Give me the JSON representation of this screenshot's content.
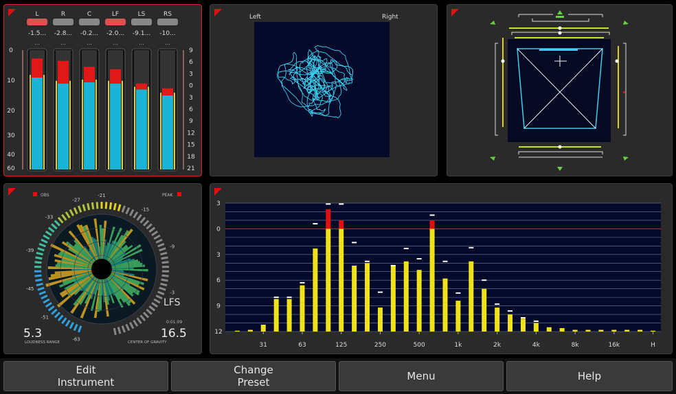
{
  "level_meter": {
    "channels": [
      {
        "label": "L",
        "value": "-1.5...",
        "peak": "...",
        "over": true,
        "level": 0.77,
        "peak_level": 0.93
      },
      {
        "label": "R",
        "value": "-2.8...",
        "peak": "...",
        "over": false,
        "level": 0.72,
        "peak_level": 0.91
      },
      {
        "label": "C",
        "value": "-0.2...",
        "peak": "...",
        "over": false,
        "level": 0.73,
        "peak_level": 0.86
      },
      {
        "label": "LF",
        "value": "-2.0...",
        "peak": "...",
        "over": true,
        "level": 0.72,
        "peak_level": 0.84
      },
      {
        "label": "LS",
        "value": "-9.1...",
        "peak": "...",
        "over": false,
        "level": 0.67,
        "peak_level": 0.72
      },
      {
        "label": "RS",
        "value": "-10...",
        "peak": "...",
        "over": false,
        "level": 0.62,
        "peak_level": 0.68
      }
    ],
    "left_scale": [
      "0",
      "10",
      "20",
      "30",
      "40",
      "60"
    ],
    "right_scale": [
      "9",
      "6",
      "3",
      "0",
      "3",
      "6",
      "9",
      "12",
      "15",
      "18",
      "21"
    ]
  },
  "vectorscope": {
    "left_label": "Left",
    "right_label": "Right"
  },
  "loudness": {
    "obs_label": "OBS",
    "peak_label": "PEAK",
    "scale": [
      "-21",
      "-15",
      "-9",
      "-3",
      "-63",
      "-51",
      "-45",
      "-39",
      "-33",
      "-27"
    ],
    "loudness_range_value": "5.3",
    "loudness_range_label": "LOUDNESS RANGE",
    "cog_value": "16.5",
    "cog_label": "CENTER OF GRAVITY",
    "mode": "LFS",
    "time": "0:01:09"
  },
  "spectrum": {
    "y_ticks": [
      "3",
      "0",
      "3",
      "6",
      "9",
      "12"
    ],
    "x_labels": [
      "31",
      "63",
      "125",
      "250",
      "500",
      "1k",
      "2k",
      "4k",
      "8k",
      "16k",
      "H"
    ],
    "chart_data": {
      "type": "bar",
      "ylabel": "",
      "xlabel": "",
      "ylim": [
        12,
        -3
      ],
      "values": [
        11.9,
        11.8,
        11.2,
        8.2,
        8.2,
        6.6,
        2.3,
        -2.3,
        -1.0,
        4.3,
        4.0,
        9.2,
        4.3,
        3.8,
        4.8,
        -1.0,
        5.8,
        8.4,
        3.8,
        7.0,
        9.2,
        10.0,
        10.5,
        11.0,
        11.5,
        11.6,
        11.8,
        11.8,
        11.8,
        11.8,
        11.8,
        11.8,
        11.9
      ],
      "peaks": [
        null,
        null,
        null,
        8.0,
        8.0,
        6.3,
        -0.6,
        -2.9,
        -2.9,
        1.6,
        3.8,
        7.4,
        4.3,
        2.3,
        3.5,
        -1.6,
        3.8,
        7.5,
        2.2,
        6.0,
        8.8,
        9.6,
        10.4,
        10.8,
        null,
        null,
        null,
        null,
        null,
        null,
        null,
        null,
        null
      ]
    }
  },
  "buttons": {
    "edit": "Edit\nInstrument",
    "change_preset": "Change\nPreset",
    "menu": "Menu",
    "help": "Help"
  },
  "colors": {
    "bar_yellow": "#f0e21a",
    "bar_red": "#e01010",
    "meter_cyan": "#1cb4d6",
    "meter_red": "#e01818",
    "trace_cyan": "#3ad0f0"
  }
}
